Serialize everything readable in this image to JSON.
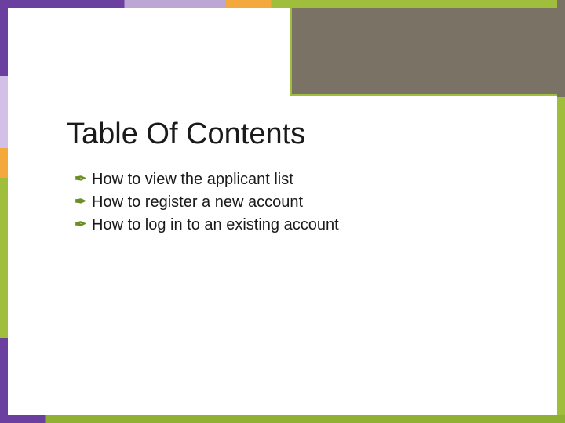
{
  "title": "Table Of Contents",
  "items": [
    {
      "text": "How to view the applicant list"
    },
    {
      "text": "How to register a new account"
    },
    {
      "text": "How to log in to an existing account"
    }
  ],
  "bullet_glyph": "✒"
}
